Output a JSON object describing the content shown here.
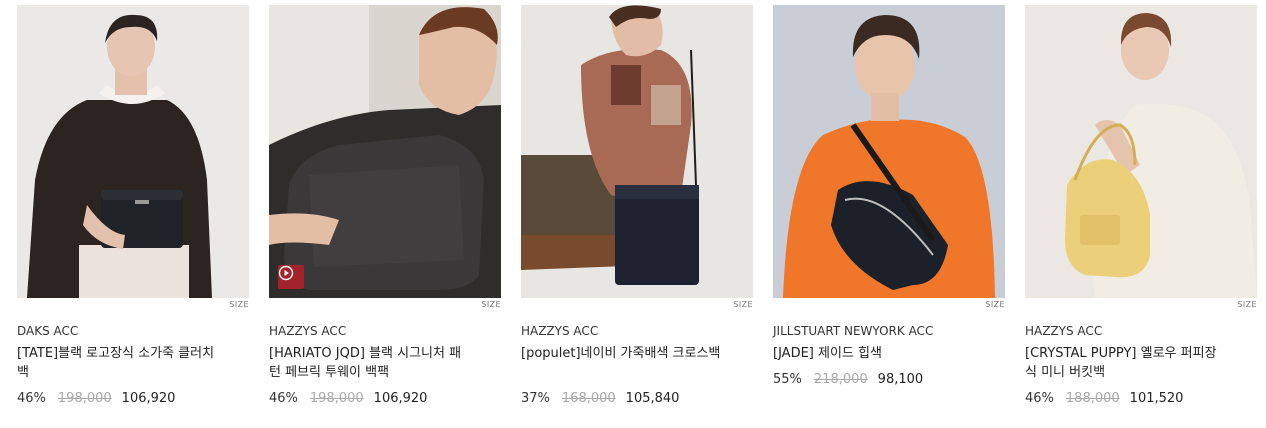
{
  "products": [
    {
      "brand": "DAKS ACC",
      "title": "[TATE]블랙 로고장식 소가죽 클러치백",
      "discount": "46%",
      "original_price": "198,000",
      "sale_price": "106,920",
      "size_tag": "SIZE",
      "has_video": false
    },
    {
      "brand": "HAZZYS ACC",
      "title": "[HARIATO JQD] 블랙 시그니처 패턴 페브릭 투웨이 백팩",
      "discount": "46%",
      "original_price": "198,000",
      "sale_price": "106,920",
      "size_tag": "SIZE",
      "has_video": true
    },
    {
      "brand": "HAZZYS ACC",
      "title": "[populet]네이비 가죽배색 크로스백",
      "discount": "37%",
      "original_price": "168,000",
      "sale_price": "105,840",
      "size_tag": "SIZE",
      "has_video": false
    },
    {
      "brand": "JILLSTUART NEWYORK ACC",
      "title": "[JADE] 제이드 힙색",
      "discount": "55%",
      "original_price": "218,000",
      "sale_price": "98,100",
      "size_tag": "SIZE",
      "has_video": false
    },
    {
      "brand": "HAZZYS ACC",
      "title": "[CRYSTAL PUPPY] 옐로우 퍼피장식 미니 버킷백",
      "discount": "46%",
      "original_price": "188,000",
      "sale_price": "101,520",
      "size_tag": "SIZE",
      "has_video": false
    }
  ],
  "colors": {
    "video_badge": "#a3232a",
    "strike_price": "#aaaaaa"
  }
}
